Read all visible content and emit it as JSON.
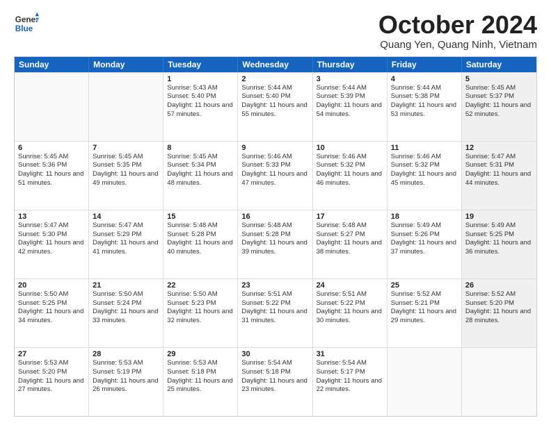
{
  "header": {
    "logo": {
      "general": "General",
      "blue": "Blue"
    },
    "month": "October 2024",
    "location": "Quang Yen, Quang Ninh, Vietnam"
  },
  "days_of_week": [
    "Sunday",
    "Monday",
    "Tuesday",
    "Wednesday",
    "Thursday",
    "Friday",
    "Saturday"
  ],
  "weeks": [
    [
      {
        "day": "",
        "sunrise": "",
        "sunset": "",
        "daylight": "",
        "shaded": false,
        "empty": true
      },
      {
        "day": "",
        "sunrise": "",
        "sunset": "",
        "daylight": "",
        "shaded": false,
        "empty": true
      },
      {
        "day": "1",
        "sunrise": "Sunrise: 5:43 AM",
        "sunset": "Sunset: 5:40 PM",
        "daylight": "Daylight: 11 hours and 57 minutes.",
        "shaded": false,
        "empty": false
      },
      {
        "day": "2",
        "sunrise": "Sunrise: 5:44 AM",
        "sunset": "Sunset: 5:40 PM",
        "daylight": "Daylight: 11 hours and 55 minutes.",
        "shaded": false,
        "empty": false
      },
      {
        "day": "3",
        "sunrise": "Sunrise: 5:44 AM",
        "sunset": "Sunset: 5:39 PM",
        "daylight": "Daylight: 11 hours and 54 minutes.",
        "shaded": false,
        "empty": false
      },
      {
        "day": "4",
        "sunrise": "Sunrise: 5:44 AM",
        "sunset": "Sunset: 5:38 PM",
        "daylight": "Daylight: 11 hours and 53 minutes.",
        "shaded": false,
        "empty": false
      },
      {
        "day": "5",
        "sunrise": "Sunrise: 5:45 AM",
        "sunset": "Sunset: 5:37 PM",
        "daylight": "Daylight: 11 hours and 52 minutes.",
        "shaded": true,
        "empty": false
      }
    ],
    [
      {
        "day": "6",
        "sunrise": "Sunrise: 5:45 AM",
        "sunset": "Sunset: 5:36 PM",
        "daylight": "Daylight: 11 hours and 51 minutes.",
        "shaded": false,
        "empty": false
      },
      {
        "day": "7",
        "sunrise": "Sunrise: 5:45 AM",
        "sunset": "Sunset: 5:35 PM",
        "daylight": "Daylight: 11 hours and 49 minutes.",
        "shaded": false,
        "empty": false
      },
      {
        "day": "8",
        "sunrise": "Sunrise: 5:45 AM",
        "sunset": "Sunset: 5:34 PM",
        "daylight": "Daylight: 11 hours and 48 minutes.",
        "shaded": false,
        "empty": false
      },
      {
        "day": "9",
        "sunrise": "Sunrise: 5:46 AM",
        "sunset": "Sunset: 5:33 PM",
        "daylight": "Daylight: 11 hours and 47 minutes.",
        "shaded": false,
        "empty": false
      },
      {
        "day": "10",
        "sunrise": "Sunrise: 5:46 AM",
        "sunset": "Sunset: 5:32 PM",
        "daylight": "Daylight: 11 hours and 46 minutes.",
        "shaded": false,
        "empty": false
      },
      {
        "day": "11",
        "sunrise": "Sunrise: 5:46 AM",
        "sunset": "Sunset: 5:32 PM",
        "daylight": "Daylight: 11 hours and 45 minutes.",
        "shaded": false,
        "empty": false
      },
      {
        "day": "12",
        "sunrise": "Sunrise: 5:47 AM",
        "sunset": "Sunset: 5:31 PM",
        "daylight": "Daylight: 11 hours and 44 minutes.",
        "shaded": true,
        "empty": false
      }
    ],
    [
      {
        "day": "13",
        "sunrise": "Sunrise: 5:47 AM",
        "sunset": "Sunset: 5:30 PM",
        "daylight": "Daylight: 11 hours and 42 minutes.",
        "shaded": false,
        "empty": false
      },
      {
        "day": "14",
        "sunrise": "Sunrise: 5:47 AM",
        "sunset": "Sunset: 5:29 PM",
        "daylight": "Daylight: 11 hours and 41 minutes.",
        "shaded": false,
        "empty": false
      },
      {
        "day": "15",
        "sunrise": "Sunrise: 5:48 AM",
        "sunset": "Sunset: 5:28 PM",
        "daylight": "Daylight: 11 hours and 40 minutes.",
        "shaded": false,
        "empty": false
      },
      {
        "day": "16",
        "sunrise": "Sunrise: 5:48 AM",
        "sunset": "Sunset: 5:28 PM",
        "daylight": "Daylight: 11 hours and 39 minutes.",
        "shaded": false,
        "empty": false
      },
      {
        "day": "17",
        "sunrise": "Sunrise: 5:48 AM",
        "sunset": "Sunset: 5:27 PM",
        "daylight": "Daylight: 11 hours and 38 minutes.",
        "shaded": false,
        "empty": false
      },
      {
        "day": "18",
        "sunrise": "Sunrise: 5:49 AM",
        "sunset": "Sunset: 5:26 PM",
        "daylight": "Daylight: 11 hours and 37 minutes.",
        "shaded": false,
        "empty": false
      },
      {
        "day": "19",
        "sunrise": "Sunrise: 5:49 AM",
        "sunset": "Sunset: 5:25 PM",
        "daylight": "Daylight: 11 hours and 36 minutes.",
        "shaded": true,
        "empty": false
      }
    ],
    [
      {
        "day": "20",
        "sunrise": "Sunrise: 5:50 AM",
        "sunset": "Sunset: 5:25 PM",
        "daylight": "Daylight: 11 hours and 34 minutes.",
        "shaded": false,
        "empty": false
      },
      {
        "day": "21",
        "sunrise": "Sunrise: 5:50 AM",
        "sunset": "Sunset: 5:24 PM",
        "daylight": "Daylight: 11 hours and 33 minutes.",
        "shaded": false,
        "empty": false
      },
      {
        "day": "22",
        "sunrise": "Sunrise: 5:50 AM",
        "sunset": "Sunset: 5:23 PM",
        "daylight": "Daylight: 11 hours and 32 minutes.",
        "shaded": false,
        "empty": false
      },
      {
        "day": "23",
        "sunrise": "Sunrise: 5:51 AM",
        "sunset": "Sunset: 5:22 PM",
        "daylight": "Daylight: 11 hours and 31 minutes.",
        "shaded": false,
        "empty": false
      },
      {
        "day": "24",
        "sunrise": "Sunrise: 5:51 AM",
        "sunset": "Sunset: 5:22 PM",
        "daylight": "Daylight: 11 hours and 30 minutes.",
        "shaded": false,
        "empty": false
      },
      {
        "day": "25",
        "sunrise": "Sunrise: 5:52 AM",
        "sunset": "Sunset: 5:21 PM",
        "daylight": "Daylight: 11 hours and 29 minutes.",
        "shaded": false,
        "empty": false
      },
      {
        "day": "26",
        "sunrise": "Sunrise: 5:52 AM",
        "sunset": "Sunset: 5:20 PM",
        "daylight": "Daylight: 11 hours and 28 minutes.",
        "shaded": true,
        "empty": false
      }
    ],
    [
      {
        "day": "27",
        "sunrise": "Sunrise: 5:53 AM",
        "sunset": "Sunset: 5:20 PM",
        "daylight": "Daylight: 11 hours and 27 minutes.",
        "shaded": false,
        "empty": false
      },
      {
        "day": "28",
        "sunrise": "Sunrise: 5:53 AM",
        "sunset": "Sunset: 5:19 PM",
        "daylight": "Daylight: 11 hours and 26 minutes.",
        "shaded": false,
        "empty": false
      },
      {
        "day": "29",
        "sunrise": "Sunrise: 5:53 AM",
        "sunset": "Sunset: 5:18 PM",
        "daylight": "Daylight: 11 hours and 25 minutes.",
        "shaded": false,
        "empty": false
      },
      {
        "day": "30",
        "sunrise": "Sunrise: 5:54 AM",
        "sunset": "Sunset: 5:18 PM",
        "daylight": "Daylight: 11 hours and 23 minutes.",
        "shaded": false,
        "empty": false
      },
      {
        "day": "31",
        "sunrise": "Sunrise: 5:54 AM",
        "sunset": "Sunset: 5:17 PM",
        "daylight": "Daylight: 11 hours and 22 minutes.",
        "shaded": false,
        "empty": false
      },
      {
        "day": "",
        "sunrise": "",
        "sunset": "",
        "daylight": "",
        "shaded": false,
        "empty": true
      },
      {
        "day": "",
        "sunrise": "",
        "sunset": "",
        "daylight": "",
        "shaded": true,
        "empty": true
      }
    ]
  ]
}
